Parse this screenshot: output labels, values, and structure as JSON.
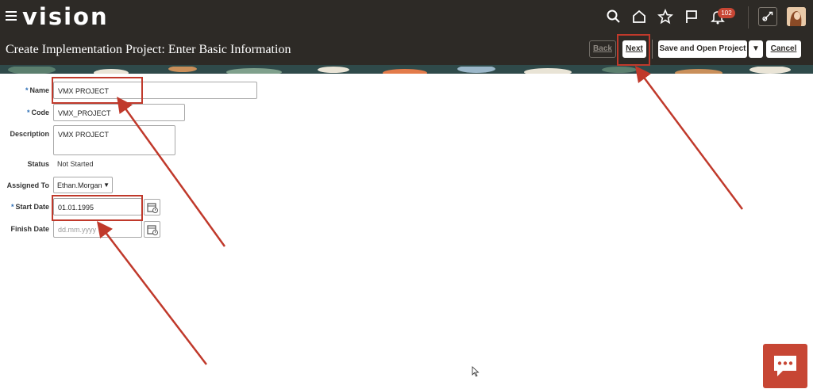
{
  "app": {
    "logo": "vision"
  },
  "topbar": {
    "icons": [
      "menu-icon",
      "search-icon",
      "home-icon",
      "favorites-star-icon",
      "flag-icon",
      "bell-icon",
      "tool-icon",
      "user-avatar"
    ],
    "notification_count": "102"
  },
  "page": {
    "title": "Create Implementation Project: Enter Basic Information",
    "buttons": {
      "back": "Back",
      "next": "Next",
      "save_open": "Save and Open Project",
      "dropdown": "▼",
      "cancel": "Cancel"
    }
  },
  "form": {
    "name": {
      "label": "Name",
      "value": "VMX PROJECT",
      "required": true
    },
    "code": {
      "label": "Code",
      "value": "VMX_PROJECT",
      "required": true
    },
    "description": {
      "label": "Description",
      "value": "VMX PROJECT"
    },
    "status": {
      "label": "Status",
      "value": "Not Started"
    },
    "assigned_to": {
      "label": "Assigned To",
      "value": "Ethan.Morgan"
    },
    "start_date": {
      "label": "Start Date",
      "value": "01.01.1995",
      "required": true
    },
    "finish_date": {
      "label": "Finish Date",
      "placeholder": "dd.mm.yyyy"
    }
  },
  "colors": {
    "header_bg": "#2d2a26",
    "accent_red": "#c74634",
    "annotation_red": "#c0392b",
    "required_marker": "#2b6db5"
  }
}
